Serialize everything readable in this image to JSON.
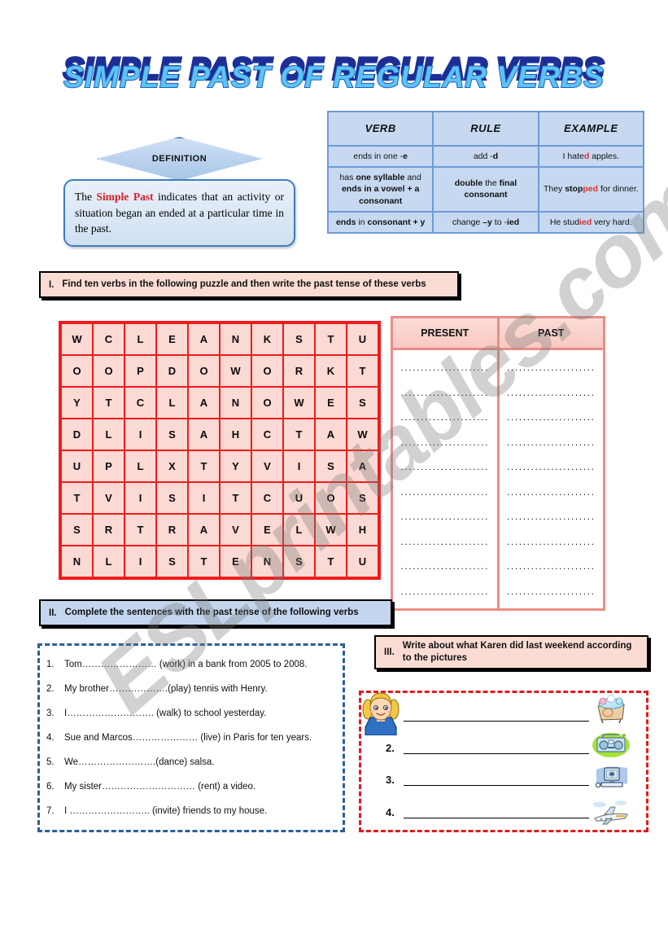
{
  "title": "SIMPLE PAST OF REGULAR VERBS",
  "watermark": "ESLprintables.com",
  "definition": {
    "label": "DEFINITION",
    "text_before": "The ",
    "highlight": "Simple Past",
    "text_after": " indicates that an activity or situation began an ended at a particular time in the past."
  },
  "rules_table": {
    "headers": [
      "VERB",
      "RULE",
      "EXAMPLE"
    ],
    "rows": [
      {
        "verb_html": "ends in one -<b>e</b>",
        "rule_html": "add -<b>d</b>",
        "example_html": "I hate<span class=\"red\">d</span> apples."
      },
      {
        "verb_html": "has <b>one syllable</b> and <b>ends in a vowel + a consonant</b>",
        "rule_html": "<b>double</b> the <b>final consonant</b>",
        "example_html": "They <b>stop<span class=\"red\">ped</span></b> for dinner."
      },
      {
        "verb_html": "<b>ends</b> in <b>consonant + y</b>",
        "rule_html": "change <b>–y</b> to -<b>ied</b>",
        "example_html": "He stud<span class=\"red\">ied</span> very hard."
      }
    ]
  },
  "exercise1": {
    "number": "I.",
    "instruction": "Find ten  verbs in the following puzzle and then write the past tense of these verbs",
    "grid": [
      [
        "W",
        "C",
        "L",
        "E",
        "A",
        "N",
        "K",
        "S",
        "T",
        "U"
      ],
      [
        "O",
        "O",
        "P",
        "D",
        "O",
        "W",
        "O",
        "R",
        "K",
        "T"
      ],
      [
        "Y",
        "T",
        "C",
        "L",
        "A",
        "N",
        "O",
        "W",
        "E",
        "S"
      ],
      [
        "D",
        "L",
        "I",
        "S",
        "A",
        "H",
        "C",
        "T",
        "A",
        "W"
      ],
      [
        "U",
        "P",
        "L",
        "X",
        "T",
        "Y",
        "V",
        "I",
        "S",
        "A"
      ],
      [
        "T",
        "V",
        "I",
        "S",
        "I",
        "T",
        "C",
        "U",
        "O",
        "S"
      ],
      [
        "S",
        "R",
        "T",
        "R",
        "A",
        "V",
        "E",
        "L",
        "W",
        "H"
      ],
      [
        "N",
        "L",
        "I",
        "S",
        "T",
        "E",
        "N",
        "S",
        "T",
        "U"
      ]
    ],
    "answer_table": {
      "headers": [
        "PRESENT",
        "PAST"
      ],
      "row_count": 10,
      "dots": "......................"
    }
  },
  "exercise2": {
    "number": "II.",
    "instruction": "Complete the sentences with the past tense of the following verbs",
    "sentences": [
      {
        "num": "1.",
        "text": "Tom…………………… (work)  in a bank from 2005 to 2008."
      },
      {
        "num": "2.",
        "text": "My brother……………….(play)  tennis with Henry."
      },
      {
        "num": "3.",
        "text": "I………………………. (walk) to school yesterday."
      },
      {
        "num": "4.",
        "text": "Sue and Marcos………………… (live) in Paris for ten years."
      },
      {
        "num": "5.",
        "text": "We…………………….(dance) salsa."
      },
      {
        "num": "6.",
        "text": "My sister………………………… (rent) a video."
      },
      {
        "num": "7.",
        "text": "I …………………….. (invite) friends to my house."
      }
    ]
  },
  "exercise3": {
    "number": "III.",
    "instruction": "Write about what Karen did last weekend according to the pictures",
    "answers": [
      {
        "num": ""
      },
      {
        "num": "2."
      },
      {
        "num": "3."
      },
      {
        "num": "4."
      }
    ],
    "pictures": [
      "bath-icon",
      "radio-icon",
      "computer-icon",
      "airplane-icon"
    ],
    "character": "karen-girl-illustration"
  },
  "colors": {
    "title_front": "#5fc3f2",
    "title_back": "#1d2f96",
    "grid_border": "#ee1c1c",
    "grid_cell": "#fbd9d4",
    "pink_banner": "#fbdcd4",
    "blue_banner": "#c3d6ee",
    "rules_cell": "#c6d9f0",
    "accent_red": "#d81f26"
  }
}
